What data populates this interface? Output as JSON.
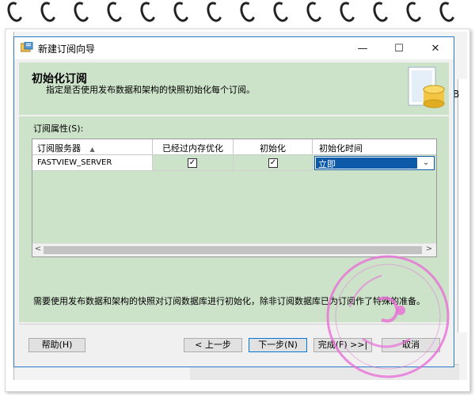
{
  "window": {
    "title": "新建订阅向导",
    "minimize_glyph": "—",
    "maximize_glyph": "☐",
    "close_glyph": "✕"
  },
  "header": {
    "title": "初始化订阅",
    "subtitle": "指定是否使用发布数据和架构的快照初始化每个订阅。"
  },
  "side_text": "B",
  "properties": {
    "label": "订阅属性(S):",
    "columns": [
      "订阅服务器",
      "已经过内存优化",
      "初始化",
      "初始化时间"
    ],
    "rows": [
      {
        "subscriber": "FASTVIEW_SERVER",
        "memory_optimized": true,
        "initialize": true,
        "init_time": "立即"
      }
    ]
  },
  "note": "需要使用发布数据和架构的快照对订阅数据库进行初始化，除非订阅数据库已为订阅作了特殊的准备。",
  "buttons": {
    "help": "帮助(H)",
    "back": "< 上一步",
    "next": "下一步(N)",
    "finish": "完成(F) >>|",
    "cancel": "取消"
  },
  "icons": {
    "sort": "sort-asc-icon",
    "dropdown": "chevron-down-icon",
    "header_art": "database-icon"
  },
  "colors": {
    "header_bg": "#cde3c9",
    "selection": "#0c5aa8",
    "stamp": "#e86fd8"
  }
}
